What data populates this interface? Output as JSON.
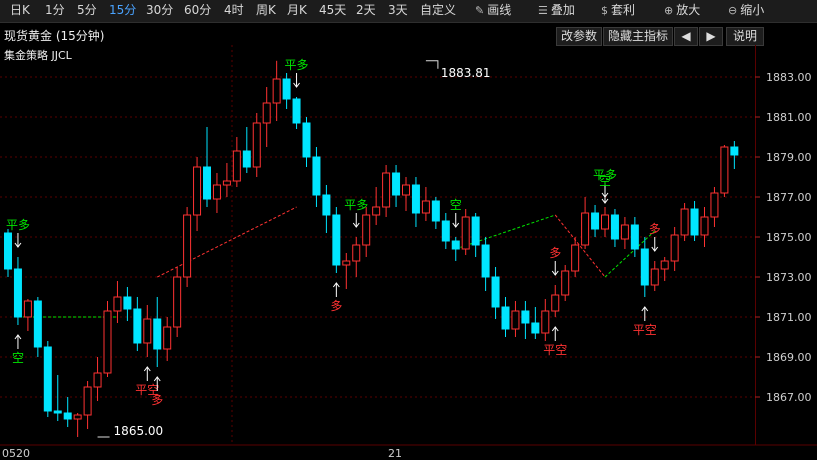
{
  "toolbar": {
    "items": [
      {
        "label": "日K",
        "active": false
      },
      {
        "label": "1分",
        "active": false
      },
      {
        "label": "5分",
        "active": false
      },
      {
        "label": "15分",
        "active": true
      },
      {
        "label": "30分",
        "active": false
      },
      {
        "label": "60分",
        "active": false
      },
      {
        "label": "4时",
        "active": false
      },
      {
        "label": "周K",
        "active": false
      },
      {
        "label": "月K",
        "active": false
      },
      {
        "label": "45天",
        "active": false
      },
      {
        "label": "2天",
        "active": false
      },
      {
        "label": "3天",
        "active": false
      },
      {
        "label": "自定义",
        "active": false
      }
    ],
    "tools": [
      {
        "label": "画线",
        "icon": "pencil-icon",
        "glyph": "✎"
      },
      {
        "label": "叠加",
        "icon": "layers-icon",
        "glyph": "☰"
      },
      {
        "label": "套利",
        "icon": "money-bag-icon",
        "glyph": "$"
      },
      {
        "label": "放大",
        "icon": "zoom-in-icon",
        "glyph": "⊕"
      },
      {
        "label": "缩小",
        "icon": "zoom-out-icon",
        "glyph": "⊖"
      }
    ]
  },
  "header": {
    "title": "现货黄金 (15分钟)",
    "buttons": {
      "params": "改参数",
      "hide": "隐藏主指标",
      "prev": "◀",
      "next": "▶",
      "help": "说明"
    }
  },
  "strategy_label": "集金策略  JJCL",
  "colors": {
    "up": "#ff3232",
    "down": "#00e5ff",
    "grid": "#5a0000",
    "green_signal": "#00e600",
    "red_signal": "#ff3232",
    "axis_text": "#cfcfcf"
  },
  "chart_data": {
    "type": "candlestick",
    "y_ticks": [
      1883.0,
      1881.0,
      1879.0,
      1877.0,
      1875.0,
      1873.0,
      1871.0,
      1869.0,
      1867.0
    ],
    "ylim": [
      1864.6,
      1884.6
    ],
    "x_labels": [
      {
        "label": "0520",
        "index": 0
      },
      {
        "label": "21",
        "index": 39
      }
    ],
    "annotations": [
      {
        "text": "1883.81",
        "index": 42,
        "value": 1883.81
      },
      {
        "text": "1865.00",
        "index": 9,
        "value": 1865.0
      }
    ],
    "candles": [
      [
        1875.2,
        1875.4,
        1873.0,
        1873.4
      ],
      [
        1873.4,
        1874.0,
        1870.6,
        1871.0
      ],
      [
        1871.0,
        1871.9,
        1870.3,
        1871.8
      ],
      [
        1871.8,
        1872.0,
        1869.0,
        1869.5
      ],
      [
        1869.5,
        1869.8,
        1866.0,
        1866.3
      ],
      [
        1866.3,
        1868.1,
        1865.8,
        1866.2
      ],
      [
        1866.2,
        1867.0,
        1865.5,
        1865.9
      ],
      [
        1865.9,
        1866.2,
        1865.0,
        1866.1
      ],
      [
        1866.1,
        1867.8,
        1865.4,
        1867.5
      ],
      [
        1867.5,
        1869.0,
        1866.8,
        1868.2
      ],
      [
        1868.2,
        1871.8,
        1868.0,
        1871.3
      ],
      [
        1871.3,
        1872.8,
        1870.7,
        1872.0
      ],
      [
        1872.0,
        1872.5,
        1870.8,
        1871.4
      ],
      [
        1871.4,
        1872.0,
        1869.3,
        1869.7
      ],
      [
        1869.7,
        1871.6,
        1869.0,
        1870.9
      ],
      [
        1870.9,
        1872.0,
        1868.5,
        1869.4
      ],
      [
        1869.4,
        1871.0,
        1868.8,
        1870.5
      ],
      [
        1870.5,
        1873.5,
        1870.0,
        1873.0
      ],
      [
        1873.0,
        1876.5,
        1872.5,
        1876.1
      ],
      [
        1876.1,
        1879.0,
        1875.3,
        1878.5
      ],
      [
        1878.5,
        1880.5,
        1876.5,
        1876.9
      ],
      [
        1876.9,
        1878.2,
        1876.2,
        1877.6
      ],
      [
        1877.6,
        1878.7,
        1877.0,
        1877.8
      ],
      [
        1877.8,
        1880.0,
        1877.5,
        1879.3
      ],
      [
        1879.3,
        1880.5,
        1878.2,
        1878.5
      ],
      [
        1878.5,
        1881.2,
        1878.0,
        1880.7
      ],
      [
        1880.7,
        1882.5,
        1879.5,
        1881.7
      ],
      [
        1881.7,
        1883.81,
        1880.8,
        1882.9
      ],
      [
        1882.9,
        1883.2,
        1881.4,
        1881.9
      ],
      [
        1881.9,
        1882.0,
        1880.4,
        1880.7
      ],
      [
        1880.7,
        1881.0,
        1878.5,
        1879.0
      ],
      [
        1879.0,
        1879.5,
        1876.5,
        1877.1
      ],
      [
        1877.1,
        1877.6,
        1875.2,
        1876.1
      ],
      [
        1876.1,
        1876.5,
        1873.2,
        1873.6
      ],
      [
        1873.6,
        1874.2,
        1872.4,
        1873.8
      ],
      [
        1873.8,
        1875.0,
        1873.0,
        1874.6
      ],
      [
        1874.6,
        1876.5,
        1874.0,
        1876.1
      ],
      [
        1876.1,
        1877.5,
        1875.6,
        1876.5
      ],
      [
        1876.5,
        1878.6,
        1876.0,
        1878.2
      ],
      [
        1878.2,
        1878.6,
        1876.5,
        1877.1
      ],
      [
        1877.1,
        1878.0,
        1876.3,
        1877.6
      ],
      [
        1877.6,
        1878.0,
        1875.5,
        1876.2
      ],
      [
        1876.2,
        1877.5,
        1875.8,
        1876.8
      ],
      [
        1876.8,
        1877.0,
        1875.4,
        1875.8
      ],
      [
        1875.8,
        1876.2,
        1874.4,
        1874.8
      ],
      [
        1874.8,
        1875.0,
        1873.8,
        1874.4
      ],
      [
        1874.4,
        1876.4,
        1874.1,
        1876.0
      ],
      [
        1876.0,
        1876.2,
        1874.0,
        1874.6
      ],
      [
        1874.6,
        1875.0,
        1872.3,
        1873.0
      ],
      [
        1873.0,
        1873.5,
        1870.9,
        1871.5
      ],
      [
        1871.5,
        1872.0,
        1870.0,
        1870.4
      ],
      [
        1870.4,
        1871.8,
        1870.0,
        1871.3
      ],
      [
        1871.3,
        1871.8,
        1869.9,
        1870.7
      ],
      [
        1870.7,
        1871.5,
        1869.9,
        1870.2
      ],
      [
        1870.2,
        1871.9,
        1869.8,
        1871.3
      ],
      [
        1871.3,
        1872.6,
        1871.0,
        1872.1
      ],
      [
        1872.1,
        1873.6,
        1871.8,
        1873.3
      ],
      [
        1873.3,
        1875.0,
        1873.0,
        1874.6
      ],
      [
        1874.6,
        1877.0,
        1874.4,
        1876.2
      ],
      [
        1876.2,
        1876.6,
        1875.0,
        1875.4
      ],
      [
        1875.4,
        1876.5,
        1875.0,
        1876.1
      ],
      [
        1876.1,
        1876.4,
        1874.5,
        1874.9
      ],
      [
        1874.9,
        1876.0,
        1874.4,
        1875.6
      ],
      [
        1875.6,
        1876.0,
        1874.0,
        1874.4
      ],
      [
        1874.4,
        1875.0,
        1872.0,
        1872.6
      ],
      [
        1872.6,
        1873.8,
        1872.3,
        1873.4
      ],
      [
        1873.4,
        1874.0,
        1872.8,
        1873.8
      ],
      [
        1873.8,
        1875.5,
        1873.3,
        1875.1
      ],
      [
        1875.1,
        1876.7,
        1874.8,
        1876.4
      ],
      [
        1876.4,
        1876.8,
        1874.8,
        1875.1
      ],
      [
        1875.1,
        1876.5,
        1874.5,
        1876.0
      ],
      [
        1876.0,
        1877.5,
        1875.5,
        1877.2
      ],
      [
        1877.2,
        1879.6,
        1877.0,
        1879.5
      ],
      [
        1879.5,
        1879.8,
        1878.4,
        1879.1
      ]
    ],
    "signals": [
      {
        "index": 1,
        "text": "平多",
        "side": "above",
        "color": "green",
        "arrow": "down"
      },
      {
        "index": 1,
        "text": "空",
        "side": "below",
        "color": "green",
        "arrow": "up"
      },
      {
        "index": 14,
        "text": "平空",
        "side": "below",
        "color": "red",
        "arrow": "up"
      },
      {
        "index": 15,
        "text": "多",
        "side": "below",
        "color": "red",
        "arrow": "up"
      },
      {
        "index": 29,
        "text": "平多",
        "side": "above",
        "color": "green",
        "arrow": "down"
      },
      {
        "index": 33,
        "text": "多",
        "side": "below",
        "color": "red",
        "arrow": "up"
      },
      {
        "index": 35,
        "text": "平多",
        "side": "above",
        "color": "green",
        "arrow": "down"
      },
      {
        "index": 45,
        "text": "空",
        "side": "above",
        "color": "green",
        "arrow": "down"
      },
      {
        "index": 55,
        "text": "多",
        "side": "above",
        "color": "red",
        "arrow": "down"
      },
      {
        "index": 55,
        "text": "平空",
        "side": "below",
        "color": "red",
        "arrow": "up"
      },
      {
        "index": 60,
        "text": "平多",
        "side": "above",
        "color": "green",
        "arrow": "down"
      },
      {
        "index": 60,
        "text": "空",
        "side": "above2",
        "color": "green",
        "arrow": "down"
      },
      {
        "index": 64,
        "text": "平空",
        "side": "below",
        "color": "red",
        "arrow": "up"
      },
      {
        "index": 65,
        "text": "多",
        "side": "above",
        "color": "red",
        "arrow": "down"
      }
    ],
    "trend_lines": [
      {
        "from": [
          1,
          1871.0
        ],
        "to": [
          11,
          1871.0
        ],
        "color": "green"
      },
      {
        "from": [
          15,
          1873.0
        ],
        "to": [
          29,
          1876.5
        ],
        "color": "red"
      },
      {
        "from": [
          45,
          1874.4
        ],
        "to": [
          55,
          1876.1
        ],
        "color": "green"
      },
      {
        "from": [
          55,
          1876.1
        ],
        "to": [
          60,
          1873.0
        ],
        "color": "red"
      },
      {
        "from": [
          60,
          1873.0
        ],
        "to": [
          65,
          1875.3
        ],
        "color": "green"
      }
    ]
  }
}
